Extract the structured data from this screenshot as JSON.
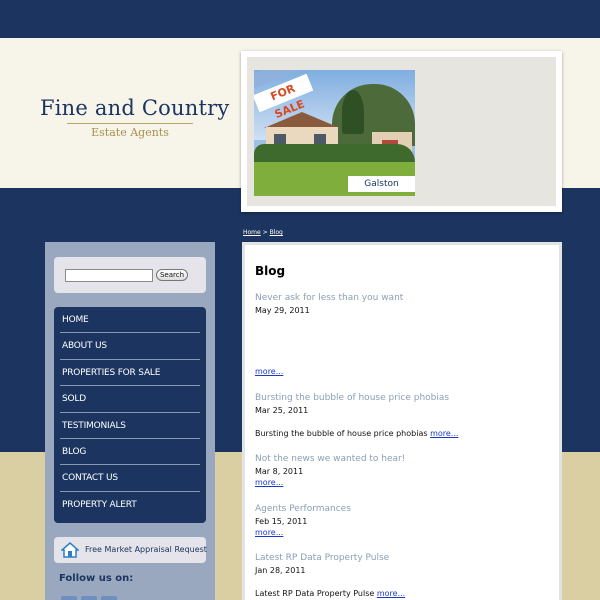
{
  "logo": {
    "name": "Fine and Country",
    "tagline": "Estate Agents"
  },
  "feature": {
    "ribbon": "FOR SALE",
    "caption": "Galston"
  },
  "breadcrumb": {
    "home": "Home",
    "separator": ">",
    "current": "Blog"
  },
  "search": {
    "placeholder": "",
    "button_label": "Search"
  },
  "nav": {
    "items": [
      {
        "label": "HOME"
      },
      {
        "label": "ABOUT US"
      },
      {
        "label": "PROPERTIES FOR SALE"
      },
      {
        "label": "SOLD"
      },
      {
        "label": "TESTIMONIALS"
      },
      {
        "label": "BLOG"
      },
      {
        "label": "CONTACT US"
      },
      {
        "label": "PROPERTY ALERT"
      }
    ]
  },
  "appraisal": {
    "label": "Free Market Appraisal Request",
    "icon": "house-icon"
  },
  "follow": {
    "label": "Follow us on:"
  },
  "content": {
    "title": "Blog",
    "more_label": "more...",
    "posts": [
      {
        "title": "Never ask for less than you want",
        "date": "May 29, 2011",
        "excerpt": ""
      },
      {
        "title": "Bursting the bubble of house price phobias",
        "date": "Mar 25, 2011",
        "excerpt": "Bursting the bubble of house price phobias"
      },
      {
        "title": "Not the news we wanted to hear!",
        "date": "Mar 8, 2011",
        "excerpt": ""
      },
      {
        "title": "Agents Performances",
        "date": "Feb 15, 2011",
        "excerpt": ""
      },
      {
        "title": "Latest RP Data Property Pulse",
        "date": "Jan 28, 2011",
        "excerpt": "Latest RP Data Property Pulse"
      }
    ]
  },
  "colors": {
    "navy": "#1c3560",
    "cream": "#f7f4ea",
    "tan": "#d9cfa2",
    "sidebar": "#9aa8bf",
    "link": "#1a3ac4",
    "post_title": "#8a9fb5"
  }
}
